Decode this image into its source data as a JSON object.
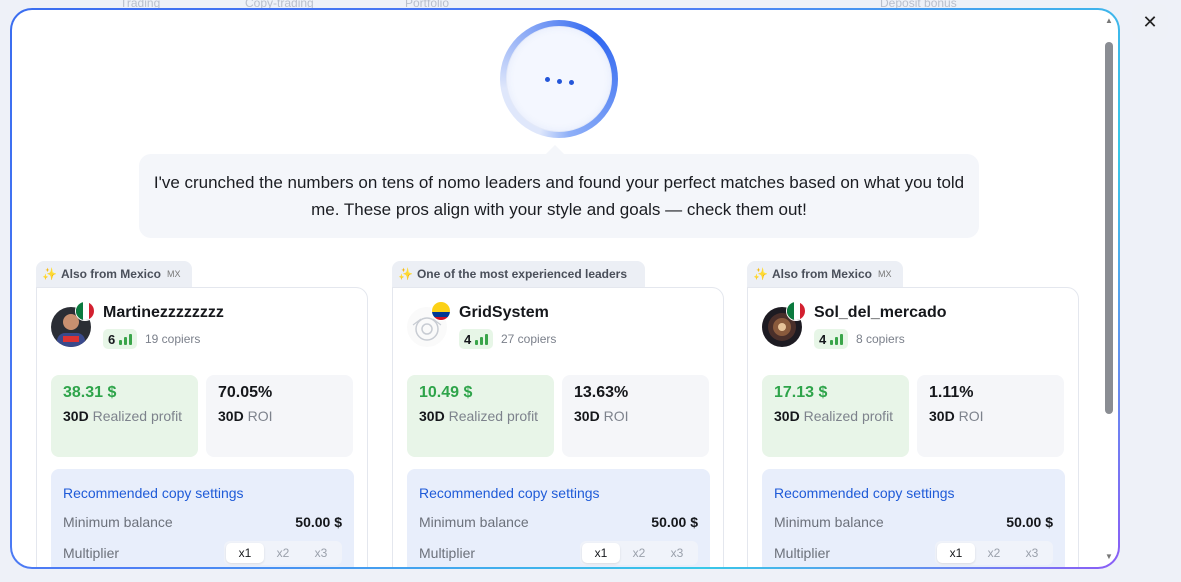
{
  "topbar": {
    "items": [
      "Trading",
      "Copy-trading",
      "Portfolio",
      "Deposit bonus"
    ]
  },
  "assistant": {
    "message": "I've crunched the numbers on tens of nomo leaders and found your perfect matches based on what you told me. These pros align with your style and goals — check them out!"
  },
  "close_label": "✕",
  "cards": [
    {
      "tag": "Also from Mexico",
      "tag_code": "MX",
      "name": "Martinezzzzzzzz",
      "level": "6",
      "copiers": "19 copiers",
      "profit_value": "38.31 $",
      "profit_label_bold": "30D",
      "profit_label_rest": " Realized profit",
      "roi_value": "70.05%",
      "roi_label_bold": "30D",
      "roi_label_rest": " ROI",
      "settings_title": "Recommended copy settings",
      "min_balance_label": "Minimum balance",
      "min_balance_value": "50.00 $",
      "multiplier_label": "Multiplier",
      "multipliers": [
        "x1",
        "x2",
        "x3"
      ],
      "flag": "mexico"
    },
    {
      "tag": "One of the most experienced leaders",
      "tag_code": "",
      "name": "GridSystem",
      "level": "4",
      "copiers": "27 copiers",
      "profit_value": "10.49 $",
      "profit_label_bold": "30D",
      "profit_label_rest": " Realized profit",
      "roi_value": "13.63%",
      "roi_label_bold": "30D",
      "roi_label_rest": " ROI",
      "settings_title": "Recommended copy settings",
      "min_balance_label": "Minimum balance",
      "min_balance_value": "50.00 $",
      "multiplier_label": "Multiplier",
      "multipliers": [
        "x1",
        "x2",
        "x3"
      ],
      "flag": "colombia"
    },
    {
      "tag": "Also from Mexico",
      "tag_code": "MX",
      "name": "Sol_del_mercado",
      "level": "4",
      "copiers": "8 copiers",
      "profit_value": "17.13 $",
      "profit_label_bold": "30D",
      "profit_label_rest": " Realized profit",
      "roi_value": "1.11%",
      "roi_label_bold": "30D",
      "roi_label_rest": " ROI",
      "settings_title": "Recommended copy settings",
      "min_balance_label": "Minimum balance",
      "min_balance_value": "50.00 $",
      "multiplier_label": "Multiplier",
      "multipliers": [
        "x1",
        "x2",
        "x3"
      ],
      "flag": "mexico"
    }
  ],
  "colors": {
    "accent": "#1f5bd8",
    "profit_green": "#2ea44a",
    "badge_green": "#e7f6e7"
  }
}
